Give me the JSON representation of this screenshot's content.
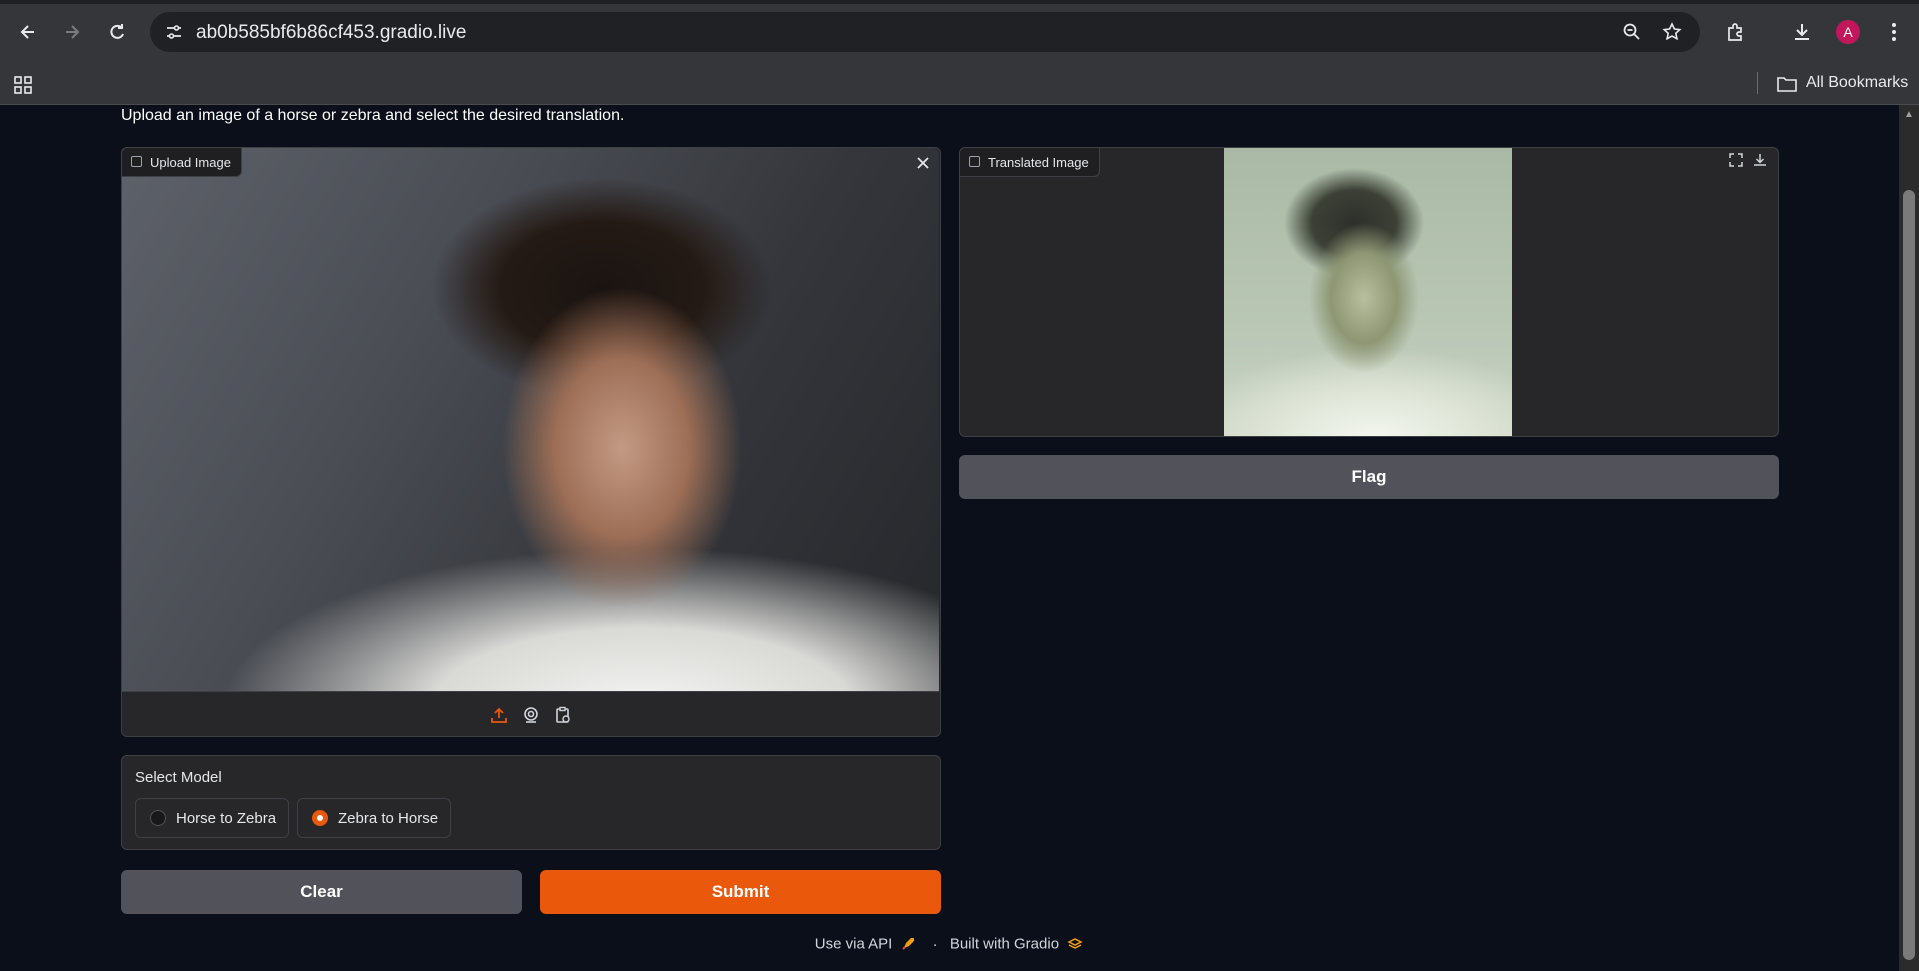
{
  "browser": {
    "url": "ab0b585bf6b86cf453.gradio.live",
    "bookmarks_label": "All Bookmarks",
    "avatar_letter": "A"
  },
  "page": {
    "description": "Upload an image of a horse or zebra and select the desired translation."
  },
  "input_image": {
    "label": "Upload Image",
    "toolbar_icons": [
      "upload-icon",
      "webcam-icon",
      "clipboard-icon"
    ]
  },
  "output_image": {
    "label": "Translated Image"
  },
  "model_select": {
    "label": "Select Model",
    "options": [
      {
        "label": "Horse to Zebra",
        "selected": false
      },
      {
        "label": "Zebra to Horse",
        "selected": true
      }
    ]
  },
  "buttons": {
    "clear": "Clear",
    "submit": "Submit",
    "flag": "Flag"
  },
  "footer": {
    "api_label": "Use via API",
    "separator": "·",
    "built_with": "Built with Gradio"
  },
  "colors": {
    "accent": "#ea580c",
    "background": "#0b0f19",
    "panel": "#27272a"
  }
}
